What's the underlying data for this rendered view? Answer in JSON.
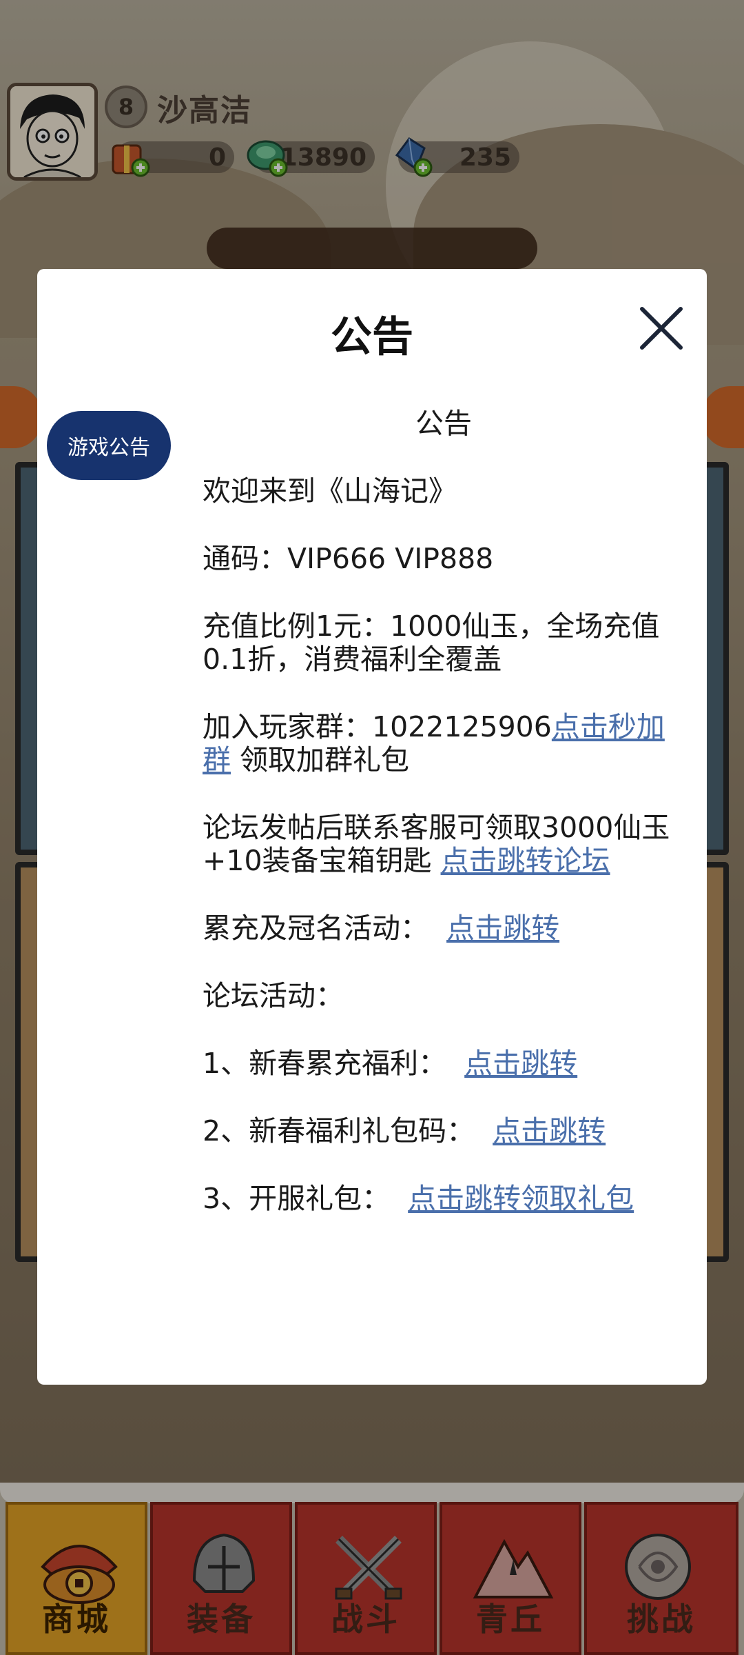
{
  "player": {
    "level": "8",
    "name": "沙高洁",
    "currencies": [
      {
        "icon": "gift-bag-icon",
        "value": "0"
      },
      {
        "icon": "jade-coin-icon",
        "value": "13890"
      },
      {
        "icon": "crystal-icon",
        "value": "235"
      }
    ]
  },
  "modal": {
    "title": "公告",
    "tab_label": "游戏公告",
    "heading": "公告",
    "welcome": "欢迎来到《山海记》",
    "codes": "通码：VIP666 VIP888",
    "recharge": "充值比例1元：1000仙玉，全场充值0.1折，消费福利全覆盖",
    "group_prefix": "加入玩家群：1022125906",
    "group_link": "点击秒加群",
    "group_suffix": " 领取加群礼包",
    "forum_text": "论坛发帖后联系客服可领取3000仙玉+10装备宝箱钥匙 ",
    "forum_link": "点击跳转论坛",
    "cumulative_text": "累充及冠名活动：",
    "cumulative_link": "点击跳转",
    "forum_activity": "论坛活动：",
    "item1_text": "1、新春累充福利：",
    "item1_link": "点击跳转",
    "item2_text": "2、新春福利礼包码：",
    "item2_link": "点击跳转",
    "item3_text": "3、开服礼包：",
    "item3_link": "点击跳转领取礼包"
  },
  "nav": [
    {
      "label": "商城",
      "icon": "shop-icon",
      "active": true
    },
    {
      "label": "装备",
      "icon": "helmet-icon",
      "active": false
    },
    {
      "label": "战斗",
      "icon": "crossed-swords-icon",
      "active": false
    },
    {
      "label": "青丘",
      "icon": "mountain-icon",
      "active": false
    },
    {
      "label": "挑战",
      "icon": "orb-icon",
      "active": false
    }
  ],
  "colors": {
    "modal_bg": "#ffffff",
    "tab_pill": "#17336e",
    "link": "#4a6fab",
    "nav_active": "#e2a326",
    "nav_inactive": "#b8342b"
  }
}
